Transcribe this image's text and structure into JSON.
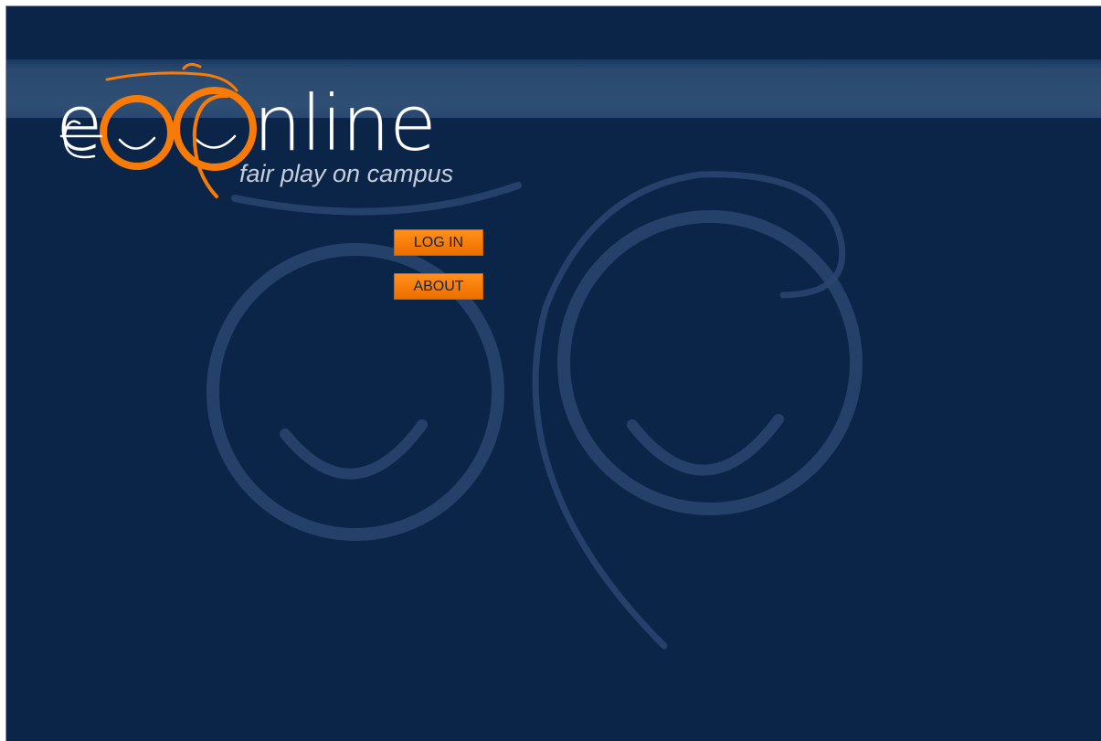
{
  "brand": {
    "logo_text": "eoonline",
    "tagline": "fair play on campus"
  },
  "nav": {
    "login_label": "LOG IN",
    "about_label": "ABOUT"
  },
  "colors": {
    "background": "#0b2549",
    "accent_orange": "#f77b06",
    "text_white": "#ffffff",
    "tagline_gray": "#c5cfdc"
  },
  "icons": {
    "logo_faces": "smiling-faces-icon",
    "watermark": "smiling-faces-watermark-icon"
  }
}
